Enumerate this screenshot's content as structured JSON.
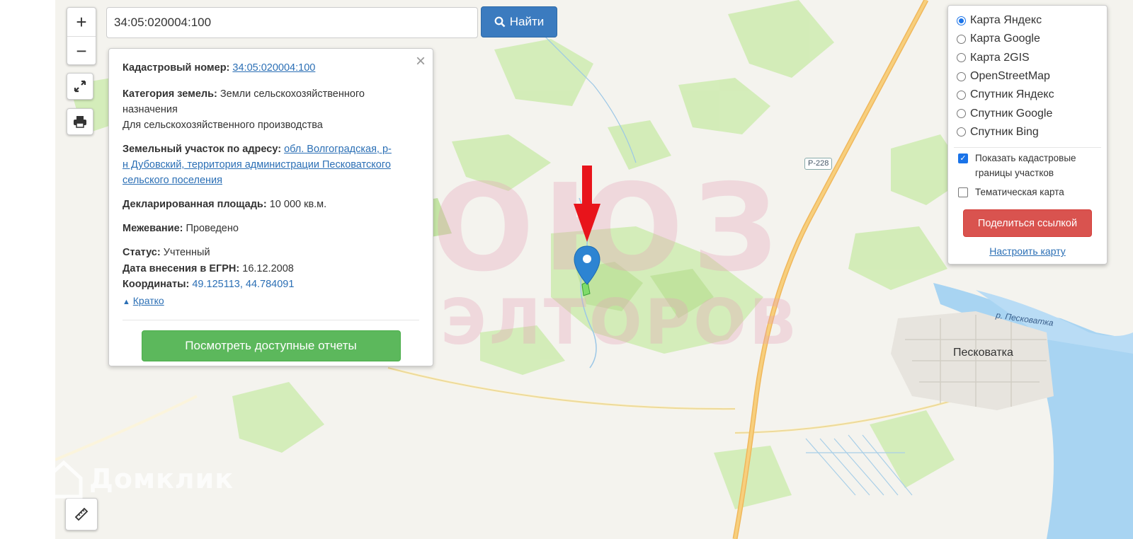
{
  "search": {
    "value": "34:05:020004:100",
    "button_label": "Найти"
  },
  "zoom": {
    "in_label": "+",
    "out_label": "−"
  },
  "popup": {
    "cad_label": "Кадастровый номер:",
    "cad_value": "34:05:020004:100",
    "cat_label": "Категория земель:",
    "cat_value_1": "Земли сельскохозяйственного",
    "cat_value_2": "назначения",
    "use_value": "Для сельскохозяйственного производства",
    "addr_label": "Земельный участок по адресу:",
    "addr_line_1": "обл. Волгоградская, р-",
    "addr_line_2": "н Дубовский, территория администрации Песковатского",
    "addr_line_3": "сельского поселения",
    "area_label": "Декларированная площадь:",
    "area_value": "10 000 кв.м.",
    "survey_label": "Межевание:",
    "survey_value": "Проведено",
    "status_label": "Статус:",
    "status_value": "Учтенный",
    "date_label": "Дата внесения в ЕГРН:",
    "date_value": "16.12.2008",
    "coords_label": "Координаты:",
    "coords_value": "49.125113, 44.784091",
    "collapse_label": "Кратко",
    "report_button": "Посмотреть доступные отчеты",
    "close": "×"
  },
  "layers": {
    "options": [
      "Карта Яндекс",
      "Карта Google",
      "Карта 2GIS",
      "OpenStreetMap",
      "Спутник Яндекс",
      "Спутник Google",
      "Спутник Bing"
    ],
    "selected": "Карта Яндекс",
    "cadastre_borders_1": "Показать кадастровые",
    "cadastre_borders_2": "границы участков",
    "thematic": "Тематическая карта",
    "share_button": "Поделиться ссылкой",
    "setup_link": "Настроить карту"
  },
  "map": {
    "watermark_line1": "СОЮЗ",
    "watermark_line2": "РИЭЛТОРОВ",
    "place_label": "Песковатка",
    "river_label": "р. Песковатка",
    "road_shield": "Р-228",
    "logo_text": "Домклик",
    "colors": {
      "water": "#a8d4f2",
      "green": "#cfeab3",
      "road": "#f5c56b"
    }
  }
}
